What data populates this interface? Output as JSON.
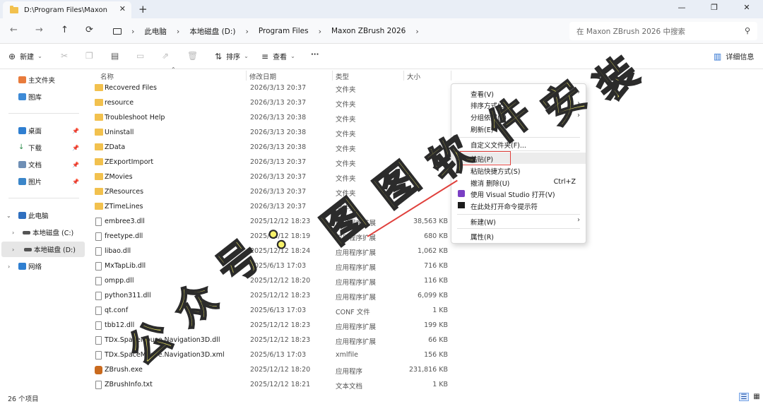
{
  "window": {
    "tab_title": "D:\\Program Files\\Maxon ZBrus",
    "tab_close": "✕",
    "new_tab": "+",
    "minimize": "—",
    "maximize": "❐",
    "close": "✕"
  },
  "nav": {
    "back": "←",
    "forward": "→",
    "up": "↑",
    "refresh": "⟳",
    "breadcrumb": [
      "此电脑",
      "本地磁盘 (D:)",
      "Program Files",
      "Maxon ZBrush 2026"
    ],
    "search_placeholder": "在 Maxon ZBrush 2026 中搜索"
  },
  "toolbar": {
    "new_label": "新建",
    "sort_label": "排序",
    "view_label": "查看",
    "more_label": "···",
    "details_label": "详细信息"
  },
  "sidebar": {
    "home": "主文件夹",
    "gallery": "图库",
    "desktop": "桌面",
    "downloads": "下载",
    "documents": "文档",
    "pictures": "图片",
    "this_pc": "此电脑",
    "drive_c": "本地磁盘 (C:)",
    "drive_d": "本地磁盘 (D:)",
    "network": "网络"
  },
  "columns": {
    "name": "名称",
    "date": "修改日期",
    "type": "类型",
    "size": "大小"
  },
  "files": [
    {
      "name": "Recovered Files",
      "date": "2026/3/13 20:37",
      "type": "文件夹",
      "size": "",
      "kind": "folder"
    },
    {
      "name": "resource",
      "date": "2026/3/13 20:37",
      "type": "文件夹",
      "size": "",
      "kind": "folder"
    },
    {
      "name": "Troubleshoot Help",
      "date": "2026/3/13 20:38",
      "type": "文件夹",
      "size": "",
      "kind": "folder"
    },
    {
      "name": "Uninstall",
      "date": "2026/3/13 20:38",
      "type": "文件夹",
      "size": "",
      "kind": "folder"
    },
    {
      "name": "ZData",
      "date": "2026/3/13 20:38",
      "type": "文件夹",
      "size": "",
      "kind": "folder"
    },
    {
      "name": "ZExportImport",
      "date": "2026/3/13 20:37",
      "type": "文件夹",
      "size": "",
      "kind": "folder"
    },
    {
      "name": "ZMovies",
      "date": "2026/3/13 20:37",
      "type": "文件夹",
      "size": "",
      "kind": "folder"
    },
    {
      "name": "ZResources",
      "date": "2026/3/13 20:37",
      "type": "文件夹",
      "size": "",
      "kind": "folder"
    },
    {
      "name": "ZTimeLines",
      "date": "2026/3/13 20:37",
      "type": "文件夹",
      "size": "",
      "kind": "folder"
    },
    {
      "name": "embree3.dll",
      "date": "2025/12/12 18:23",
      "type": "应用程序扩展",
      "size": "38,563 KB",
      "kind": "file"
    },
    {
      "name": "freetype.dll",
      "date": "2025/12/12 18:19",
      "type": "应用程序扩展",
      "size": "680 KB",
      "kind": "file"
    },
    {
      "name": "libao.dll",
      "date": "2025/12/12 18:24",
      "type": "应用程序扩展",
      "size": "1,062 KB",
      "kind": "file"
    },
    {
      "name": "MxTapLib.dll",
      "date": "2025/6/13 17:03",
      "type": "应用程序扩展",
      "size": "716 KB",
      "kind": "file"
    },
    {
      "name": "ompp.dll",
      "date": "2025/12/12 18:20",
      "type": "应用程序扩展",
      "size": "116 KB",
      "kind": "file"
    },
    {
      "name": "python311.dll",
      "date": "2025/12/12 18:23",
      "type": "应用程序扩展",
      "size": "6,099 KB",
      "kind": "file"
    },
    {
      "name": "qt.conf",
      "date": "2025/6/13 17:03",
      "type": "CONF 文件",
      "size": "1 KB",
      "kind": "file"
    },
    {
      "name": "tbb12.dll",
      "date": "2025/12/12 18:23",
      "type": "应用程序扩展",
      "size": "199 KB",
      "kind": "file"
    },
    {
      "name": "TDx.SpaceMouse.Navigation3D.dll",
      "date": "2025/12/12 18:23",
      "type": "应用程序扩展",
      "size": "66 KB",
      "kind": "file"
    },
    {
      "name": "TDx.SpaceMouse.Navigation3D.xml",
      "date": "2025/6/13 17:03",
      "type": "xmlfile",
      "size": "156 KB",
      "kind": "file"
    },
    {
      "name": "ZBrush.exe",
      "date": "2025/12/12 18:20",
      "type": "应用程序",
      "size": "231,816 KB",
      "kind": "exe"
    },
    {
      "name": "ZBrushInfo.txt",
      "date": "2025/12/12 18:21",
      "type": "文本文档",
      "size": "1 KB",
      "kind": "file"
    }
  ],
  "context_menu": {
    "view": "查看(V)",
    "sort": "排序方式(O)",
    "group": "分组依据(P)",
    "refresh": "刷新(E)",
    "customize": "自定义文件夹(F)...",
    "paste": "粘贴(P)",
    "paste_shortcut": "粘贴快捷方式(S)",
    "undo": "撤消 删除(U)",
    "undo_shortcut": "Ctrl+Z",
    "open_vs": "使用 Visual Studio 打开(V)",
    "open_cmd": "在此处打开命令提示符",
    "new": "新建(W)",
    "properties": "属性(R)"
  },
  "status": {
    "item_count": "26 个项目"
  },
  "watermark": {
    "chars": [
      "公",
      "众",
      "号",
      ":",
      "图",
      "图",
      "软",
      "件",
      "安",
      "装"
    ]
  },
  "colors": {
    "accent": "#2a6fd0",
    "highlight_box": "#e0403c",
    "watermark_fill": "#f7f26a"
  }
}
